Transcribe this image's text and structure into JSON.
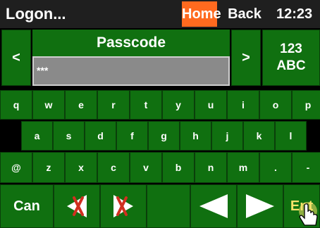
{
  "title_bar": {
    "app_title": "Logon...",
    "home_label": "Home",
    "back_label": "Back",
    "time": "12:23"
  },
  "passcode": {
    "label": "Passcode",
    "value": "***",
    "prev_label": "<",
    "next_label": ">",
    "mode_label_numeric": "123",
    "mode_label_alpha": "ABC"
  },
  "keyboard": {
    "row1": [
      "q",
      "w",
      "e",
      "r",
      "t",
      "y",
      "u",
      "i",
      "o",
      "p"
    ],
    "row2": [
      "a",
      "s",
      "d",
      "f",
      "g",
      "h",
      "j",
      "k",
      "l"
    ],
    "row3": [
      "@",
      "z",
      "x",
      "c",
      "v",
      "b",
      "n",
      "m",
      ".",
      "-"
    ]
  },
  "bottom": {
    "cancel_label": "Can",
    "enter_label": "Ent"
  },
  "colors": {
    "key_green": "#107010",
    "home_orange": "#ff6a1f",
    "field_gray": "#8a8a8a",
    "enter_yellow": "#f6e26a"
  }
}
